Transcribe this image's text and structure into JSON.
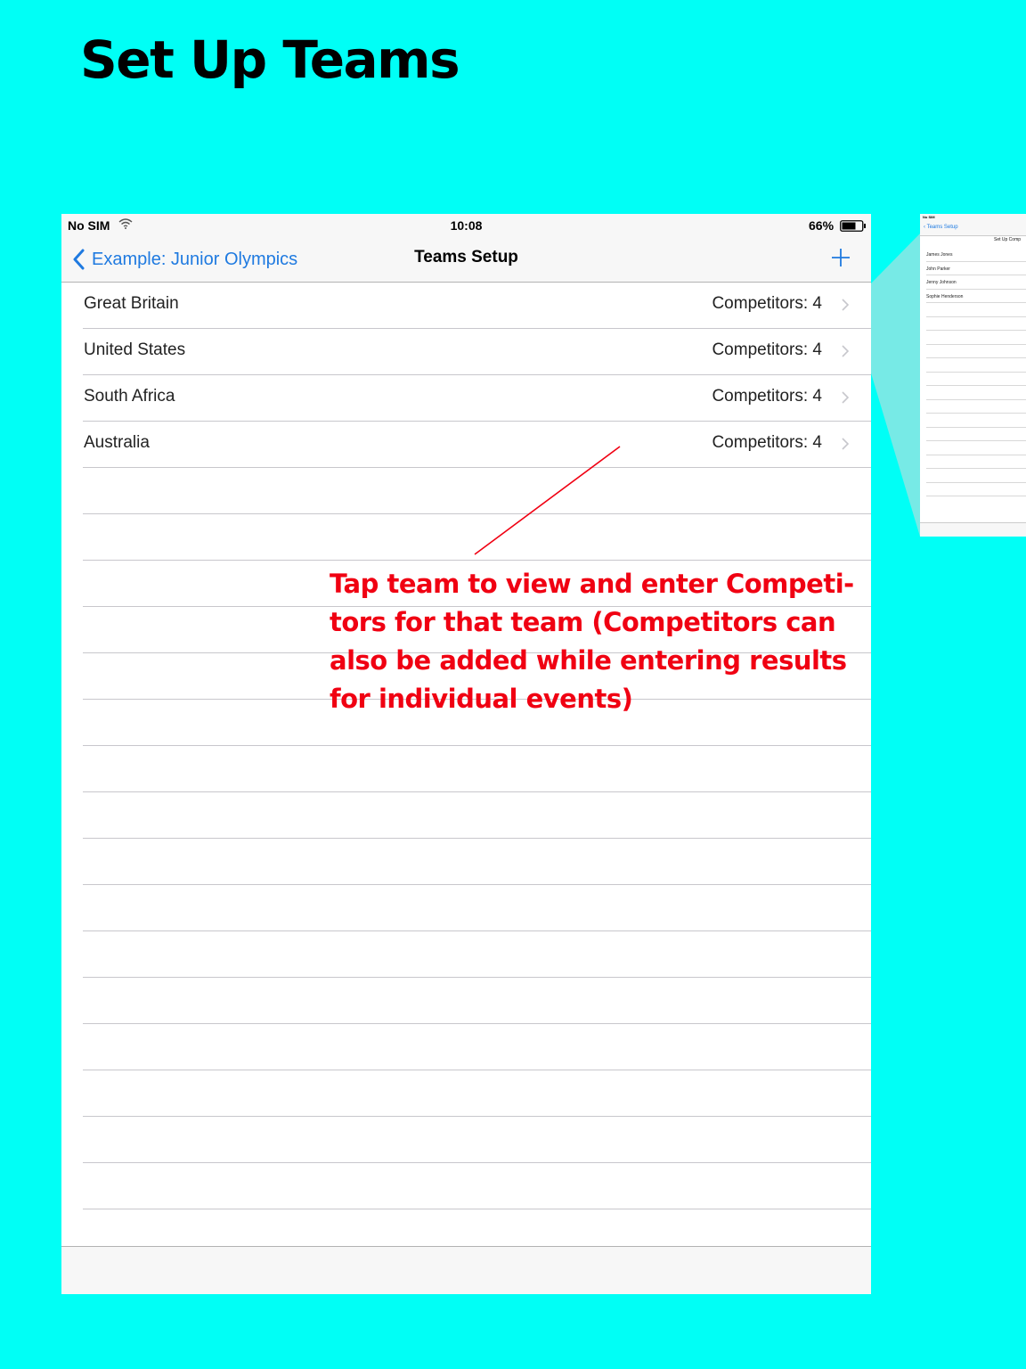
{
  "heading": "Set Up Teams",
  "status_bar": {
    "carrier": "No SIM",
    "time": "10:08",
    "battery": "66%"
  },
  "nav": {
    "back_label": "Example: Junior Olympics",
    "title": "Teams Setup"
  },
  "teams": [
    {
      "name": "Great Britain",
      "count": "Competitors: 4"
    },
    {
      "name": "United States",
      "count": "Competitors: 4"
    },
    {
      "name": "South Africa",
      "count": "Competitors: 4"
    },
    {
      "name": "Australia",
      "count": "Competitors: 4"
    }
  ],
  "callout": {
    "lines": [
      "Tap team to view and enter Competi-",
      "tors for that team (Competitors can",
      "also be added while entering results",
      "for individual events)"
    ],
    "color": "#F00012"
  },
  "thumbnail": {
    "status": "No SIM",
    "back_label": "Teams Setup",
    "subtitle": "Set Up Comp",
    "competitors": [
      "James Jones",
      "John Parker",
      "Jenny Johnson",
      "Sophie Henderson"
    ]
  },
  "colors": {
    "background": "#00FFF6",
    "accent": "#1F7AE0"
  }
}
